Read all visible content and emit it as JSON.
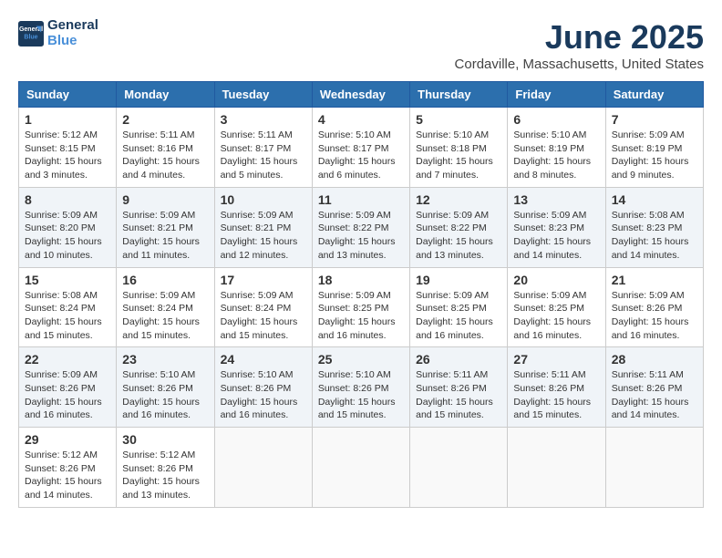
{
  "header": {
    "logo_line1": "General",
    "logo_line2": "Blue",
    "month_title": "June 2025",
    "location": "Cordaville, Massachusetts, United States"
  },
  "days_of_week": [
    "Sunday",
    "Monday",
    "Tuesday",
    "Wednesday",
    "Thursday",
    "Friday",
    "Saturday"
  ],
  "weeks": [
    [
      {
        "day": "1",
        "sunrise": "5:12 AM",
        "sunset": "8:15 PM",
        "daylight": "15 hours and 3 minutes."
      },
      {
        "day": "2",
        "sunrise": "5:11 AM",
        "sunset": "8:16 PM",
        "daylight": "15 hours and 4 minutes."
      },
      {
        "day": "3",
        "sunrise": "5:11 AM",
        "sunset": "8:17 PM",
        "daylight": "15 hours and 5 minutes."
      },
      {
        "day": "4",
        "sunrise": "5:10 AM",
        "sunset": "8:17 PM",
        "daylight": "15 hours and 6 minutes."
      },
      {
        "day": "5",
        "sunrise": "5:10 AM",
        "sunset": "8:18 PM",
        "daylight": "15 hours and 7 minutes."
      },
      {
        "day": "6",
        "sunrise": "5:10 AM",
        "sunset": "8:19 PM",
        "daylight": "15 hours and 8 minutes."
      },
      {
        "day": "7",
        "sunrise": "5:09 AM",
        "sunset": "8:19 PM",
        "daylight": "15 hours and 9 minutes."
      }
    ],
    [
      {
        "day": "8",
        "sunrise": "5:09 AM",
        "sunset": "8:20 PM",
        "daylight": "15 hours and 10 minutes."
      },
      {
        "day": "9",
        "sunrise": "5:09 AM",
        "sunset": "8:21 PM",
        "daylight": "15 hours and 11 minutes."
      },
      {
        "day": "10",
        "sunrise": "5:09 AM",
        "sunset": "8:21 PM",
        "daylight": "15 hours and 12 minutes."
      },
      {
        "day": "11",
        "sunrise": "5:09 AM",
        "sunset": "8:22 PM",
        "daylight": "15 hours and 13 minutes."
      },
      {
        "day": "12",
        "sunrise": "5:09 AM",
        "sunset": "8:22 PM",
        "daylight": "15 hours and 13 minutes."
      },
      {
        "day": "13",
        "sunrise": "5:09 AM",
        "sunset": "8:23 PM",
        "daylight": "15 hours and 14 minutes."
      },
      {
        "day": "14",
        "sunrise": "5:08 AM",
        "sunset": "8:23 PM",
        "daylight": "15 hours and 14 minutes."
      }
    ],
    [
      {
        "day": "15",
        "sunrise": "5:08 AM",
        "sunset": "8:24 PM",
        "daylight": "15 hours and 15 minutes."
      },
      {
        "day": "16",
        "sunrise": "5:09 AM",
        "sunset": "8:24 PM",
        "daylight": "15 hours and 15 minutes."
      },
      {
        "day": "17",
        "sunrise": "5:09 AM",
        "sunset": "8:24 PM",
        "daylight": "15 hours and 15 minutes."
      },
      {
        "day": "18",
        "sunrise": "5:09 AM",
        "sunset": "8:25 PM",
        "daylight": "15 hours and 16 minutes."
      },
      {
        "day": "19",
        "sunrise": "5:09 AM",
        "sunset": "8:25 PM",
        "daylight": "15 hours and 16 minutes."
      },
      {
        "day": "20",
        "sunrise": "5:09 AM",
        "sunset": "8:25 PM",
        "daylight": "15 hours and 16 minutes."
      },
      {
        "day": "21",
        "sunrise": "5:09 AM",
        "sunset": "8:26 PM",
        "daylight": "15 hours and 16 minutes."
      }
    ],
    [
      {
        "day": "22",
        "sunrise": "5:09 AM",
        "sunset": "8:26 PM",
        "daylight": "15 hours and 16 minutes."
      },
      {
        "day": "23",
        "sunrise": "5:10 AM",
        "sunset": "8:26 PM",
        "daylight": "15 hours and 16 minutes."
      },
      {
        "day": "24",
        "sunrise": "5:10 AM",
        "sunset": "8:26 PM",
        "daylight": "15 hours and 16 minutes."
      },
      {
        "day": "25",
        "sunrise": "5:10 AM",
        "sunset": "8:26 PM",
        "daylight": "15 hours and 15 minutes."
      },
      {
        "day": "26",
        "sunrise": "5:11 AM",
        "sunset": "8:26 PM",
        "daylight": "15 hours and 15 minutes."
      },
      {
        "day": "27",
        "sunrise": "5:11 AM",
        "sunset": "8:26 PM",
        "daylight": "15 hours and 15 minutes."
      },
      {
        "day": "28",
        "sunrise": "5:11 AM",
        "sunset": "8:26 PM",
        "daylight": "15 hours and 14 minutes."
      }
    ],
    [
      {
        "day": "29",
        "sunrise": "5:12 AM",
        "sunset": "8:26 PM",
        "daylight": "15 hours and 14 minutes."
      },
      {
        "day": "30",
        "sunrise": "5:12 AM",
        "sunset": "8:26 PM",
        "daylight": "15 hours and 13 minutes."
      },
      null,
      null,
      null,
      null,
      null
    ]
  ]
}
